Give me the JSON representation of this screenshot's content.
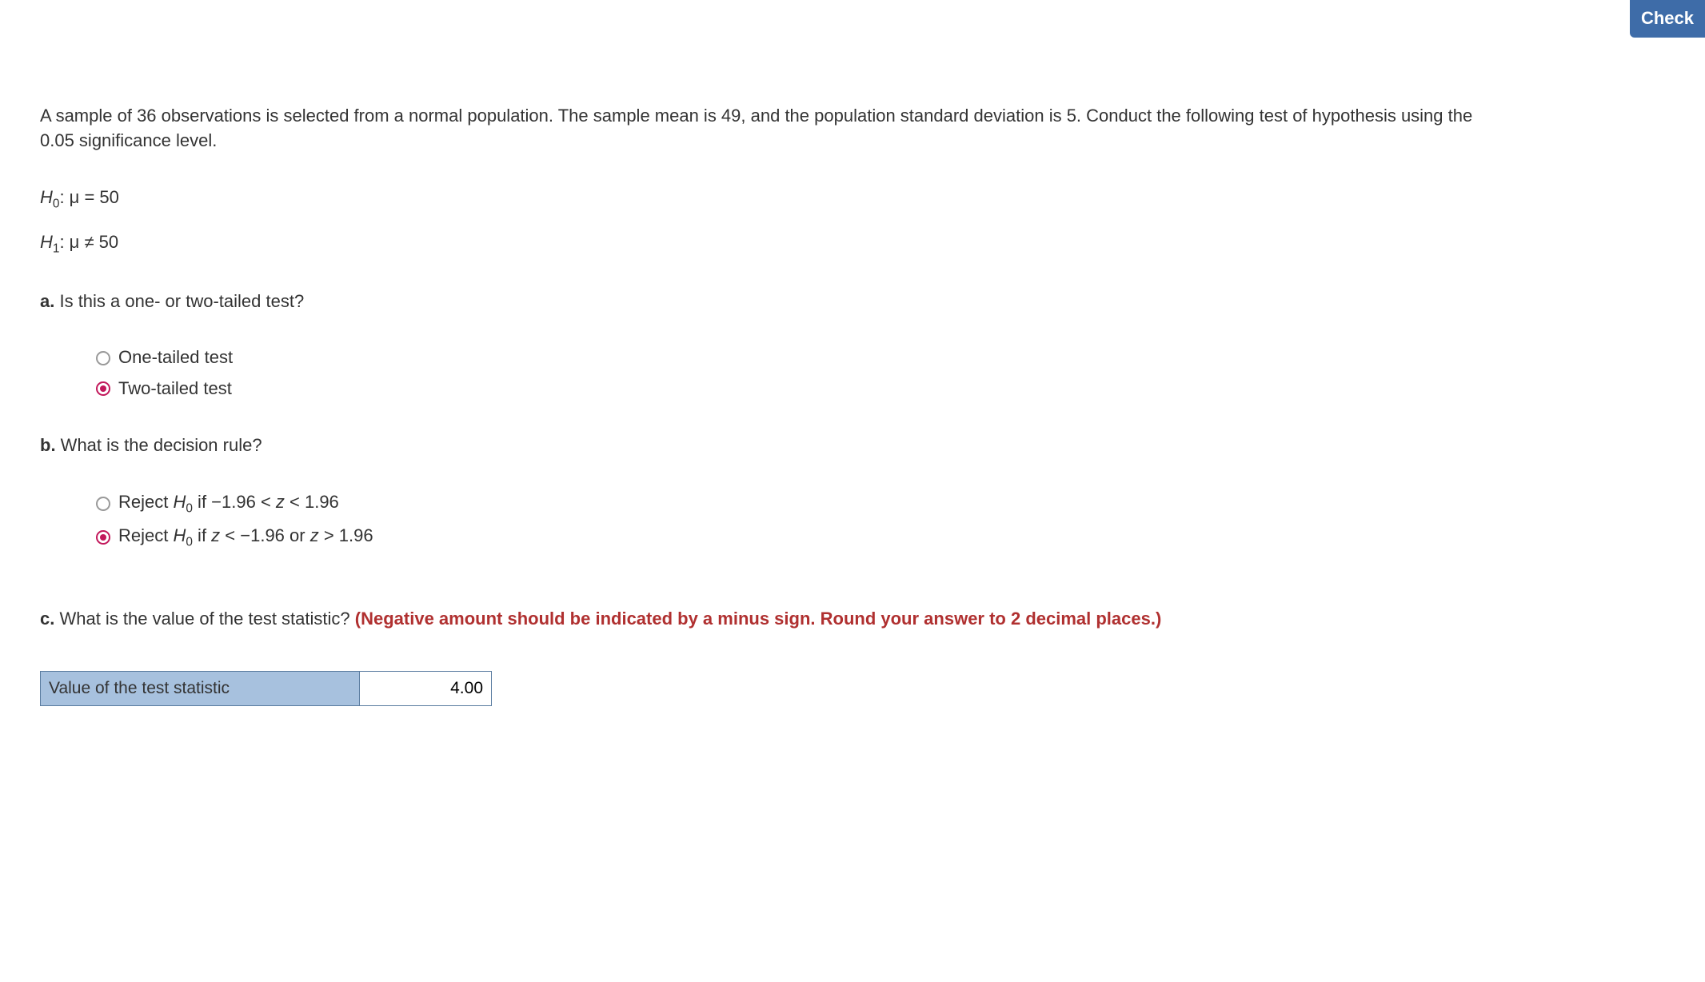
{
  "header": {
    "check_button_label": "Check"
  },
  "problem": {
    "statement": "A sample of 36 observations is selected from a normal population. The sample mean is 49, and the population standard deviation is 5. Conduct the following test of hypothesis using the 0.05 significance level.",
    "h0_subscript": "0",
    "h0_value": ": μ = 50",
    "h1_subscript": "1",
    "h1_value": ": μ ≠ 50"
  },
  "part_a": {
    "label": "a.",
    "question": " Is this a one- or two-tailed test?",
    "options": [
      {
        "label": "One-tailed test",
        "selected": false
      },
      {
        "label": "Two-tailed test",
        "selected": true
      }
    ]
  },
  "part_b": {
    "label": "b.",
    "question": " What is the decision rule?",
    "options": [
      {
        "prefix": "Reject ",
        "h_sub": "0",
        "suffix": " if −1.96 < ",
        "z": "z",
        "tail": " < 1.96",
        "selected": false
      },
      {
        "prefix": "Reject ",
        "h_sub": "0",
        "suffix": " if ",
        "z1": "z",
        "mid": " < −1.96 or ",
        "z2": "z",
        "tail": " > 1.96",
        "selected": true
      }
    ]
  },
  "part_c": {
    "label": "c.",
    "question": " What is the value of the test statistic? ",
    "instruction": "(Negative amount should be indicated by a minus sign. Round your answer to 2 decimal places.)",
    "answer_label": "Value of the test statistic",
    "answer_value": "4.00"
  }
}
